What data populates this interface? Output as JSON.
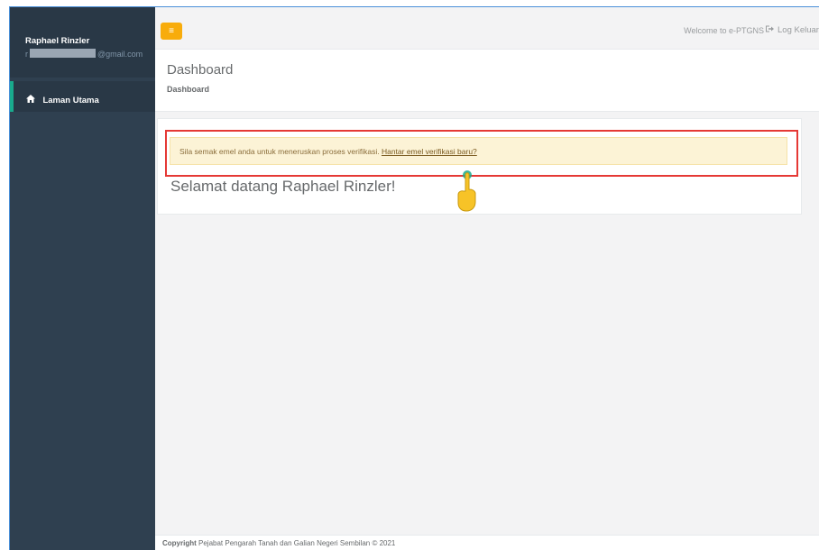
{
  "sidebar": {
    "profile": {
      "name": "Raphael Rinzler",
      "email_prefix": "r",
      "email_suffix": "@gmail.com"
    },
    "items": [
      {
        "label": "Laman Utama",
        "icon": "home-icon"
      }
    ]
  },
  "topbar": {
    "menu_icon": "≡",
    "welcome": "Welcome to e-PTGNS",
    "logout_label": "Log Keluar",
    "logout_icon": "sign-out-icon"
  },
  "heading": {
    "title": "Dashboard",
    "breadcrumb": "Dashboard"
  },
  "alert": {
    "message": "Sila semak emel anda untuk meneruskan proses verifikasi.",
    "link": "Hantar emel verifikasi baru?"
  },
  "main": {
    "greeting": "Selamat datang Raphael Rinzler!"
  },
  "footer": {
    "copyright_label": "Copyright",
    "copyright_text": "Pejabat Pengarah Tanah dan Galian Negeri Sembilan © 2021"
  },
  "colors": {
    "sidebar_bg": "#2f4050",
    "accent": "#19aa8d",
    "menu_button": "#f8ac0b",
    "alert_bg": "#fcf3d6",
    "highlight_border": "#e53935"
  }
}
